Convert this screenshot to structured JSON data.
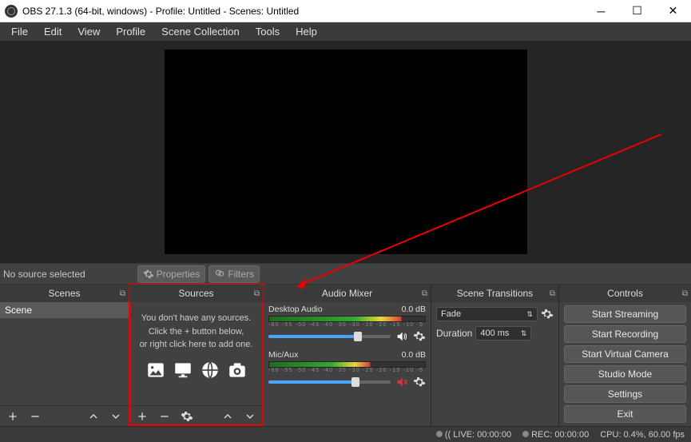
{
  "title": "OBS 27.1.3 (64-bit, windows) - Profile: Untitled - Scenes: Untitled",
  "menu": {
    "file": "File",
    "edit": "Edit",
    "view": "View",
    "profile": "Profile",
    "scene_collection": "Scene Collection",
    "tools": "Tools",
    "help": "Help"
  },
  "toolbar": {
    "no_source": "No source selected",
    "properties": "Properties",
    "filters": "Filters"
  },
  "docks": {
    "scenes": {
      "title": "Scenes",
      "items": [
        "Scene"
      ]
    },
    "sources": {
      "title": "Sources",
      "empty1": "You don't have any sources.",
      "empty2": "Click the + button below,",
      "empty3": "or right click here to add one."
    },
    "mixer": {
      "title": "Audio Mixer",
      "channels": [
        {
          "name": "Desktop Audio",
          "db": "0.0 dB",
          "ticks": "-60 -55 -50 -45 -40 -35 -30 -25 -20 -15 -10 -5 0",
          "muted": false,
          "fill": 72
        },
        {
          "name": "Mic/Aux",
          "db": "0.0 dB",
          "ticks": "-60 -55 -50 -45 -40 -35 -30 -25 -20 -15 -10 -5 0",
          "muted": true,
          "fill": 70
        }
      ]
    },
    "transitions": {
      "title": "Scene Transitions",
      "current": "Fade",
      "duration_label": "Duration",
      "duration": "400 ms"
    },
    "controls": {
      "title": "Controls",
      "buttons": {
        "streaming": "Start Streaming",
        "recording": "Start Recording",
        "vcam": "Start Virtual Camera",
        "studio": "Studio Mode",
        "settings": "Settings",
        "exit": "Exit"
      }
    }
  },
  "status": {
    "live": "LIVE: 00:00:00",
    "rec": "REC: 00:00:00",
    "cpu": "CPU: 0.4%, 60.00 fps"
  }
}
